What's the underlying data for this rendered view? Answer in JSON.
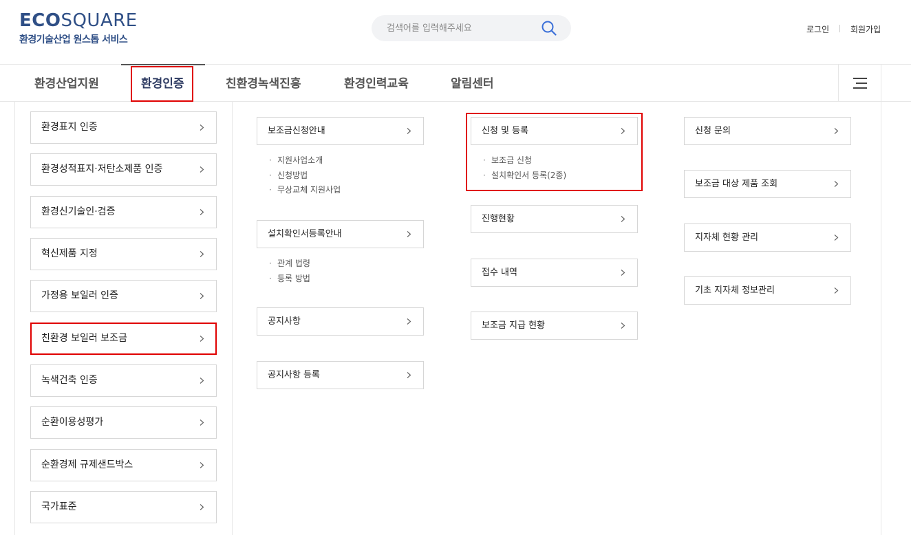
{
  "header": {
    "logo_eco": "ECO",
    "logo_square": "SQUARE",
    "logo_sub": "환경기술산업 원스톱 서비스",
    "search_placeholder": "검색어를 입력해주세요",
    "login": "로그인",
    "join": "회원가입"
  },
  "gnb": {
    "items": [
      {
        "label": "환경산업지원"
      },
      {
        "label": "환경인증"
      },
      {
        "label": "친환경녹색진흥"
      },
      {
        "label": "환경인력교육"
      },
      {
        "label": "알림센터"
      }
    ],
    "active_index": 1
  },
  "left_menu": [
    {
      "label": "환경표지 인증"
    },
    {
      "label": "환경성적표지·저탄소제품 인증"
    },
    {
      "label": "환경신기술인·검증"
    },
    {
      "label": "혁신제품 지정"
    },
    {
      "label": "가정용 보일러 인증"
    },
    {
      "label": "친환경 보일러 보조금"
    },
    {
      "label": "녹색건축 인증"
    },
    {
      "label": "순환이용성평가"
    },
    {
      "label": "순환경제 규제샌드박스"
    },
    {
      "label": "국가표준"
    }
  ],
  "columns": {
    "col1": {
      "groups": [
        {
          "label": "보조금신청안내",
          "subs": [
            "지원사업소개",
            "신청방법",
            "무상교체 지원사업"
          ]
        },
        {
          "label": "설치확인서등록안내",
          "subs": [
            "관계 법령",
            "등록 방법"
          ]
        },
        {
          "label": "공지사항",
          "subs": []
        },
        {
          "label": "공지사항 등록",
          "subs": []
        }
      ]
    },
    "col2": {
      "groups": [
        {
          "label": "신청 및 등록",
          "subs": [
            "보조금 신청",
            "설치확인서 등록(2종)"
          ]
        },
        {
          "label": "진행현황",
          "subs": []
        },
        {
          "label": "접수 내역",
          "subs": []
        },
        {
          "label": "보조금 지급 현황",
          "subs": []
        }
      ]
    },
    "col3": {
      "groups": [
        {
          "label": "신청 문의",
          "subs": []
        },
        {
          "label": "보조금 대상 제품 조회",
          "subs": []
        },
        {
          "label": "지자체 현황 관리",
          "subs": []
        },
        {
          "label": "기초 지자체 정보관리",
          "subs": []
        }
      ]
    }
  },
  "sub_bullet": "·",
  "colors": {
    "highlight": "#e00000",
    "brand": "#2f4f86",
    "search_icon": "#3a6fd8"
  }
}
